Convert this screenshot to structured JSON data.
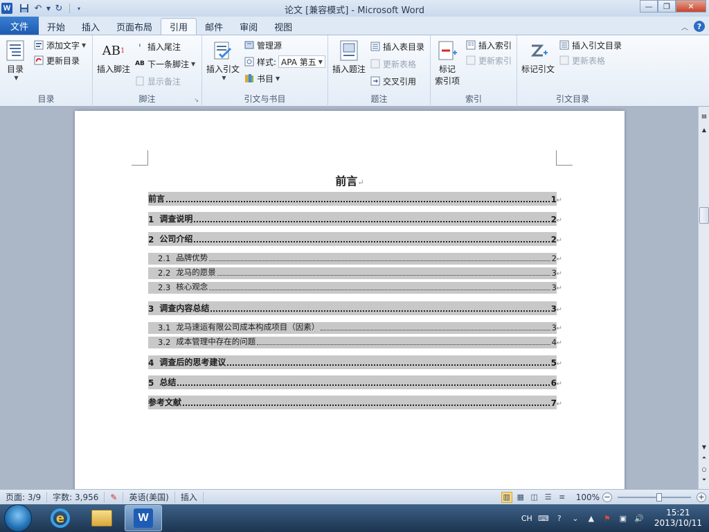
{
  "window": {
    "app_logo": "W",
    "title": "论文 [兼容模式] - Microsoft Word",
    "min_label": "—",
    "max_label": "❐",
    "close_label": "✕"
  },
  "tabs": {
    "file": "文件",
    "items": [
      "开始",
      "插入",
      "页面布局",
      "引用",
      "邮件",
      "审阅",
      "视图"
    ],
    "active_index": 3
  },
  "ribbon": {
    "toc_group": {
      "label": "目录",
      "toc_button": "目录",
      "add_text": "添加文字",
      "update_toc": "更新目录"
    },
    "footnote_group": {
      "label": "脚注",
      "insert_footnote": "插入脚注",
      "insert_endnote": "插入尾注",
      "next_footnote": "下一条脚注",
      "show_notes": "显示备注",
      "big_icon_text": "AB"
    },
    "citation_group": {
      "label": "引文与书目",
      "insert_citation": "插入引文",
      "manage_sources": "管理源",
      "style_label": "样式:",
      "style_value": "APA 第五",
      "bibliography": "书目"
    },
    "caption_group": {
      "label": "题注",
      "insert_caption": "插入题注",
      "insert_table_of_figures": "插入表目录",
      "update_table": "更新表格",
      "cross_reference": "交叉引用"
    },
    "index_group": {
      "label": "索引",
      "mark_entry": "标记\n索引项",
      "mark_entry_line1": "标记",
      "mark_entry_line2": "索引项",
      "insert_index": "插入索引",
      "update_index": "更新索引"
    },
    "authorities_group": {
      "label": "引文目录",
      "mark_citation": "标记引文",
      "insert_toa": "插入引文目录",
      "update_table": "更新表格"
    }
  },
  "document": {
    "heading": "前言",
    "paragraph_mark": "↵",
    "toc": [
      {
        "level": 1,
        "num": "",
        "text": "前言",
        "page": "1"
      },
      {
        "level": 1,
        "num": "1",
        "text": "调查说明",
        "page": "2"
      },
      {
        "level": 1,
        "num": "2",
        "text": "公司介绍",
        "page": "2"
      },
      {
        "level": 2,
        "num": "2.1",
        "text": "品牌优势",
        "page": "2"
      },
      {
        "level": 2,
        "num": "2.2",
        "text": "龙马的愿景",
        "page": "3"
      },
      {
        "level": 2,
        "num": "2.3",
        "text": "核心观念",
        "page": "3"
      },
      {
        "level": 1,
        "num": "3",
        "text": "调查内容总结",
        "page": "3"
      },
      {
        "level": 2,
        "num": "3.1",
        "text": "龙马速运有限公司成本构成项目（因素）",
        "page": "3"
      },
      {
        "level": 2,
        "num": "3.2",
        "text": "成本管理中存在的问题",
        "page": "4"
      },
      {
        "level": 1,
        "num": "4",
        "text": "调查后的思考建议",
        "page": "5"
      },
      {
        "level": 1,
        "num": "5",
        "text": "总结",
        "page": "6"
      },
      {
        "level": 1,
        "num": "",
        "text": "参考文献",
        "page": "7"
      }
    ]
  },
  "statusbar": {
    "page": "页面: 3/9",
    "words": "字数: 3,956",
    "language": "英语(美国)",
    "mode": "插入",
    "zoom": "100%",
    "zoom_minus": "−",
    "zoom_plus": "+"
  },
  "taskbar": {
    "ie_glyph": "e",
    "word_glyph": "W",
    "ime": "CH",
    "time": "15:21",
    "date": "2013/10/11"
  },
  "colors": {
    "ribbon_accent": "#1f5db5",
    "toc_highlight": "#c8c8c8"
  }
}
